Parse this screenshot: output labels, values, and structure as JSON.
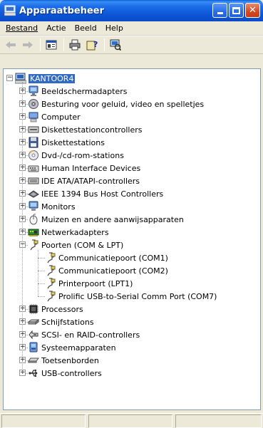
{
  "window": {
    "title": "Apparaatbeheer",
    "controls": {
      "minimize": "_",
      "maximize": "□",
      "close": "✕"
    }
  },
  "menu": [
    "Bestand",
    "Actie",
    "Beeld",
    "Help"
  ],
  "toolbar": {
    "icons": [
      "back-arrow-icon",
      "forward-arrow-icon",
      "properties-icon",
      "print-icon",
      "help-icon",
      "scan-hardware-icon"
    ]
  },
  "tree": {
    "root": "KANTOOR4",
    "categories": [
      "Beeldschermadapters",
      "Besturing voor geluid, video en spelletjes",
      "Computer",
      "Diskettestationcontrollers",
      "Diskettestations",
      "Dvd-/cd-rom-stations",
      "Human Interface Devices",
      "IDE ATA/ATAPI-controllers",
      "IEEE 1394 Bus Host Controllers",
      "Monitors",
      "Muizen en andere aanwijsapparaten",
      "Netwerkadapters",
      "Poorten (COM & LPT)",
      "Processors",
      "Schijfstations",
      "SCSI- en RAID-controllers",
      "Systeemapparaten",
      "Toetsenborden",
      "USB-controllers"
    ],
    "ports_children": [
      "Communicatiepoort (COM1)",
      "Communicatiepoort (COM2)",
      "Printerpoort (LPT1)",
      "Prolific USB-to-Serial Comm Port (COM7)"
    ]
  },
  "colors": {
    "titlebar": "#0A5FDA",
    "selection": "#316AC5",
    "chrome": "#ECE9D8"
  }
}
